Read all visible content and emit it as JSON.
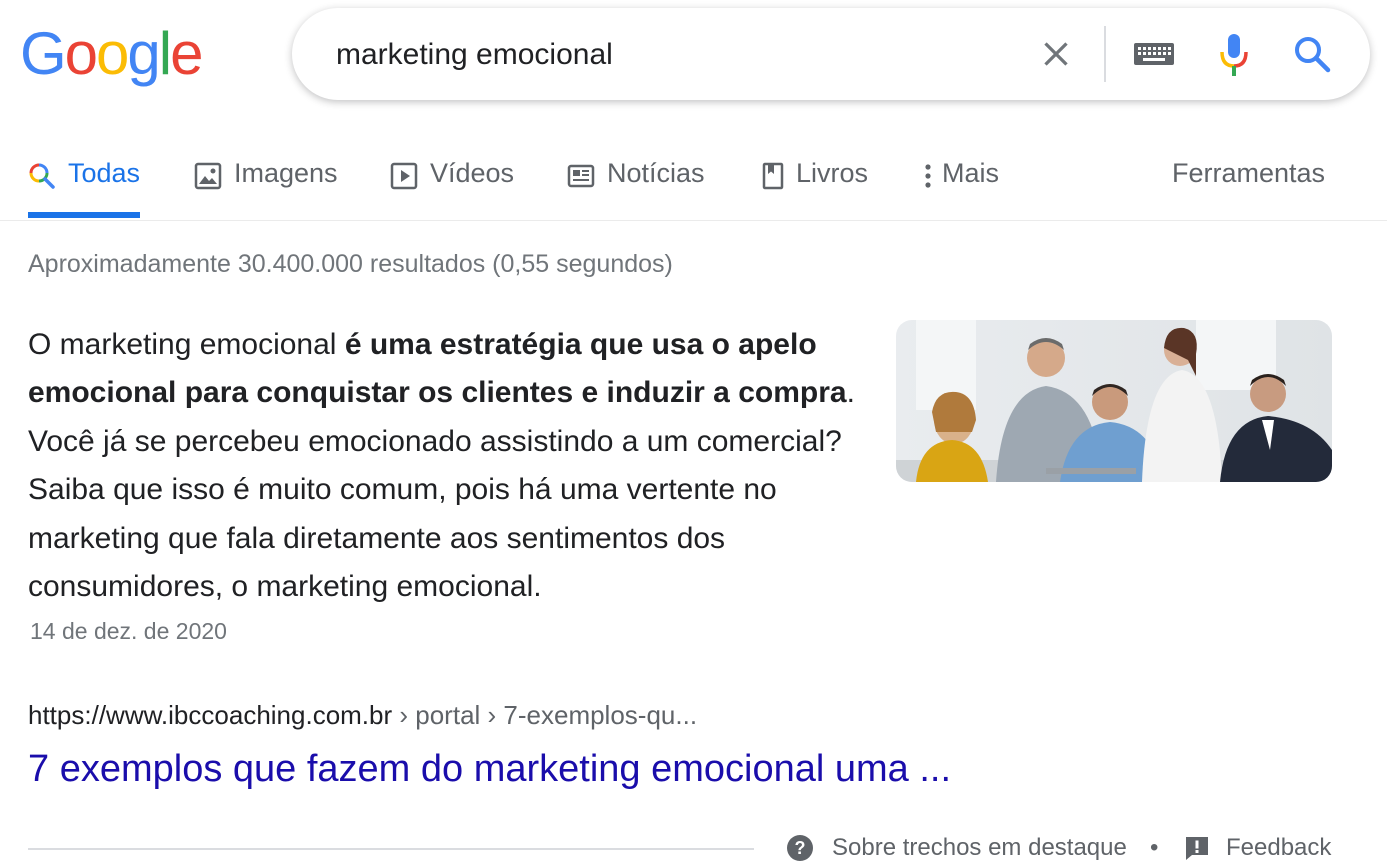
{
  "logo": {
    "text": "Google",
    "letters": [
      "G",
      "o",
      "o",
      "g",
      "l",
      "e"
    ],
    "colors": [
      "#4285F4",
      "#EA4335",
      "#FBBC05",
      "#4285F4",
      "#34A853",
      "#EA4335"
    ]
  },
  "search": {
    "query": "marketing emocional",
    "icons": [
      "close-icon",
      "keyboard-icon",
      "microphone-icon",
      "search-icon"
    ]
  },
  "tabs": [
    {
      "label": "Todas",
      "icon": "search-icon",
      "active": true
    },
    {
      "label": "Imagens",
      "icon": "image-icon"
    },
    {
      "label": "Vídeos",
      "icon": "play-icon"
    },
    {
      "label": "Notícias",
      "icon": "news-icon"
    },
    {
      "label": "Livros",
      "icon": "book-icon"
    },
    {
      "label": "Mais",
      "icon": "more-vert-icon"
    }
  ],
  "tools_label": "Ferramentas",
  "results_count": "Aproximadamente 30.400.000 resultados (0,55 segundos)",
  "featured": {
    "text_pre": "O marketing emocional ",
    "text_bold": "é uma estratégia que usa o apelo emocional para conquistar os clientes e induzir a compra",
    "text_post": ". Você já se percebeu emocionado assistindo a um comercial? Saiba que isso é muito comum, pois há uma vertente no marketing que fala diretamente aos sentimentos dos consumidores, o marketing emocional.",
    "date": "14 de dez. de 2020",
    "url_host": "https://www.ibccoaching.com.br",
    "url_crumbs": " › portal › 7-exemplos-qu...",
    "title": "7 exemplos que fazem do marketing emocional uma ..."
  },
  "footer": {
    "about_label": "Sobre trechos em destaque",
    "separator": "•",
    "feedback_label": "Feedback"
  },
  "colors": {
    "link": "#1a0dab",
    "accent": "#1a73e8",
    "muted": "#70757a"
  }
}
